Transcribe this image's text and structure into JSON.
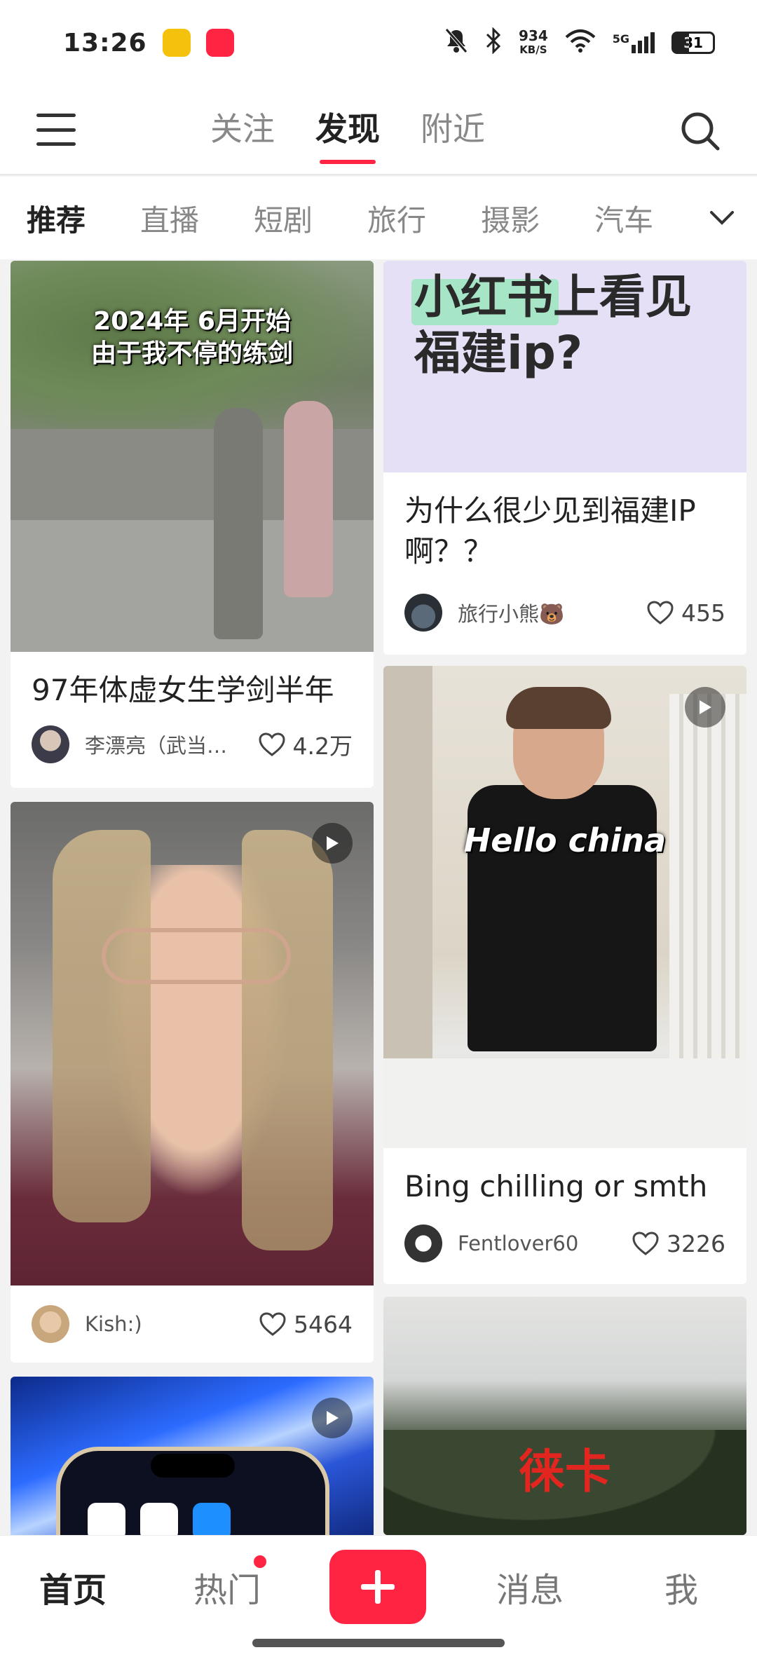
{
  "status_bar": {
    "time": "13:26",
    "net_speed_value": "934",
    "net_speed_unit": "KB/S",
    "network": "5G",
    "battery": "31"
  },
  "top_nav": {
    "tabs": [
      {
        "label": "关注"
      },
      {
        "label": "发现"
      },
      {
        "label": "附近"
      }
    ],
    "active_tab": "发现"
  },
  "categories": {
    "items": [
      "推荐",
      "直播",
      "短剧",
      "旅行",
      "摄影",
      "汽车"
    ],
    "active": "推荐"
  },
  "feed": {
    "cards": [
      {
        "title": "97年体虚女生学剑半年",
        "author": "李漂亮（武当…",
        "likes": "4.2万",
        "cover_text_line1": "2024年 6月开始",
        "cover_text_line2": "由于我不停的练剑"
      },
      {
        "cover_text_line1": "小红书上看见",
        "cover_text_line2": "福建ip?",
        "title": "为什么很少见到福建IP啊？？",
        "author": "旅行小熊🐻",
        "likes": "455"
      },
      {
        "author": "Kish:)",
        "likes": "5464"
      },
      {
        "cover_text": "Hello china",
        "title": "Bing chilling or smth",
        "author": "Fentlover60",
        "likes": "3226"
      },
      {
        "cover_text": "徕卡"
      }
    ]
  },
  "bottom_nav": {
    "items": [
      {
        "label": "首页"
      },
      {
        "label": "热门"
      },
      {
        "label": "消息"
      },
      {
        "label": "我"
      }
    ],
    "active": "首页"
  },
  "colors": {
    "accent": "#ff2442",
    "text_primary": "#222222",
    "text_secondary": "#888888"
  }
}
